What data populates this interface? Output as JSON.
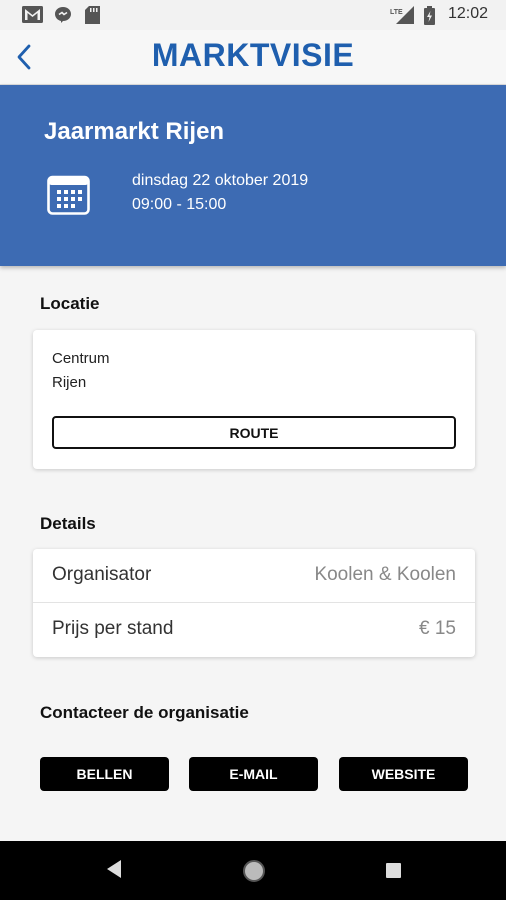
{
  "status_bar": {
    "time": "12:02",
    "icons": [
      "gmail-icon",
      "chat-icon",
      "sd-card-icon",
      "lte-signal-icon",
      "battery-icon"
    ]
  },
  "app_bar": {
    "brand": "MARKTVISIE",
    "back_icon": "chevron-left-icon"
  },
  "event": {
    "title": "Jaarmarkt Rijen",
    "date": "dinsdag 22 oktober 2019",
    "time": "09:00 - 15:00",
    "icon": "calendar-icon"
  },
  "location": {
    "heading": "Locatie",
    "line1": "Centrum",
    "line2": "Rijen",
    "route_label": "ROUTE"
  },
  "details": {
    "heading": "Details",
    "rows": [
      {
        "label": "Organisator",
        "value": "Koolen & Koolen"
      },
      {
        "label": "Prijs per stand",
        "value": "€ 15"
      }
    ]
  },
  "contact": {
    "heading": "Contacteer de organisatie",
    "buttons": [
      "BELLEN",
      "E-MAIL",
      "WEBSITE"
    ]
  },
  "nav_bar": {
    "icons": [
      "back-triangle-icon",
      "home-circle-icon",
      "recents-square-icon"
    ]
  },
  "colors": {
    "brand": "#1f5fae",
    "hero": "#3d6bb3",
    "button": "#000000"
  }
}
